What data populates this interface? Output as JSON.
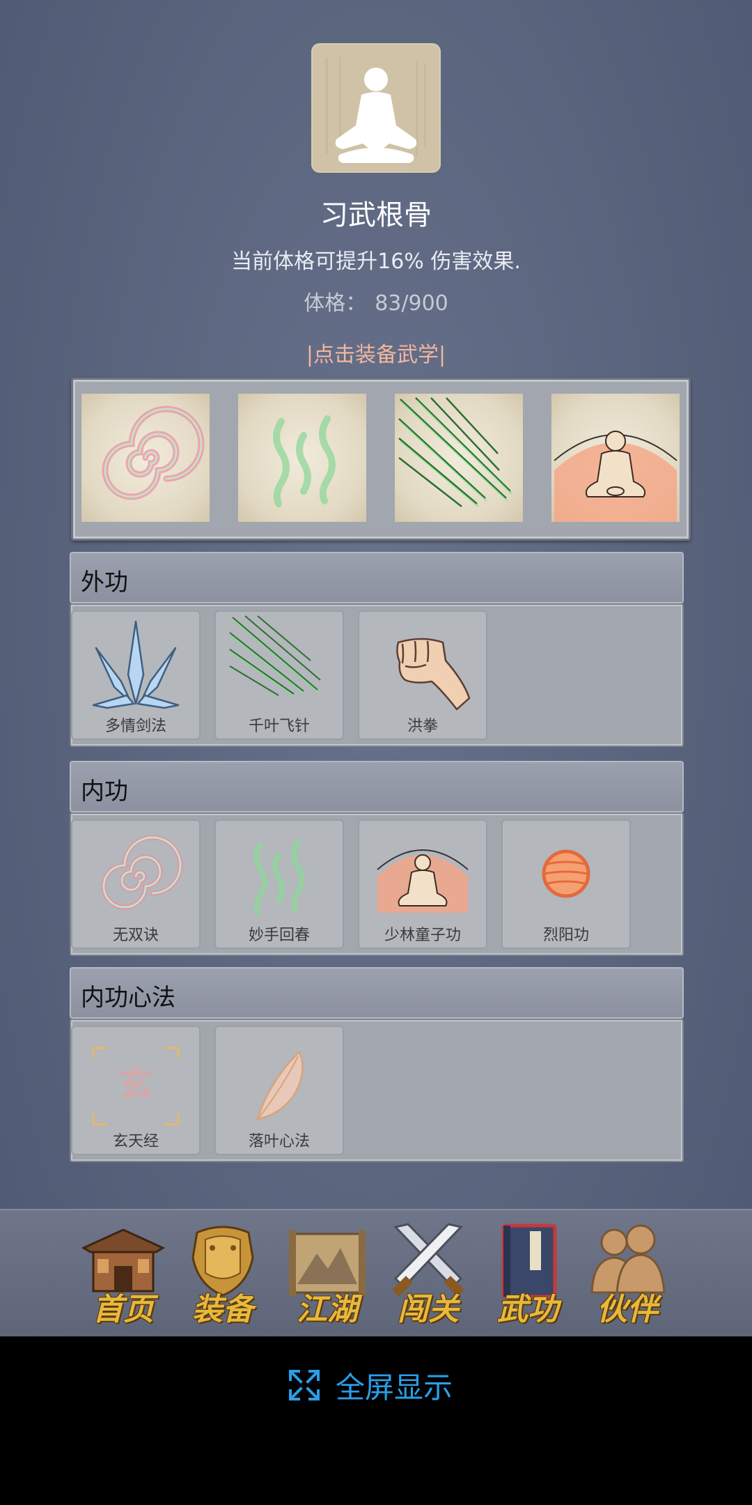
{
  "header": {
    "avatar_icon": "meditation-figure-icon",
    "title": "习武根骨",
    "description": "当前体格可提升16% 伤害效果.",
    "stat_label": "体格：",
    "stat_value": "83/900",
    "equip_hint": "|点击装备武学|"
  },
  "equipped_slots": [
    {
      "icon": "pink-spiral-icon"
    },
    {
      "icon": "green-waves-icon"
    },
    {
      "icon": "green-needles-icon"
    },
    {
      "icon": "orange-monk-icon"
    }
  ],
  "sections": [
    {
      "title": "外功",
      "items": [
        {
          "label": "多情剑法",
          "icon": "blue-crystal-swords-icon"
        },
        {
          "label": "千叶飞针",
          "icon": "green-needles-icon"
        },
        {
          "label": "洪拳",
          "icon": "fist-icon"
        }
      ]
    },
    {
      "title": "内功",
      "items": [
        {
          "label": "无双诀",
          "icon": "pink-spiral-icon"
        },
        {
          "label": "妙手回春",
          "icon": "green-waves-icon"
        },
        {
          "label": "少林童子功",
          "icon": "orange-monk-icon"
        },
        {
          "label": "烈阳功",
          "icon": "orange-sun-icon"
        }
      ]
    },
    {
      "title": "内功心法",
      "items": [
        {
          "label": "玄天经",
          "icon": "xuan-glyph-icon",
          "glyph": "玄"
        },
        {
          "label": "落叶心法",
          "icon": "feather-leaf-icon"
        }
      ]
    }
  ],
  "bottom_nav": [
    {
      "label": "首页",
      "icon": "temple-icon"
    },
    {
      "label": "装备",
      "icon": "golden-armor-icon"
    },
    {
      "label": "江湖",
      "icon": "landscape-scroll-icon"
    },
    {
      "label": "闯关",
      "icon": "crossed-swords-icon"
    },
    {
      "label": "武功",
      "icon": "martial-book-icon"
    },
    {
      "label": "伙伴",
      "icon": "companions-icon"
    }
  ],
  "fullscreen": {
    "label": "全屏显示",
    "icon": "expand-icon"
  },
  "colors": {
    "accent_hint": "#f2b6a0",
    "nav_text": "#e8b83a",
    "fullscreen_text": "#2a9ee8"
  }
}
